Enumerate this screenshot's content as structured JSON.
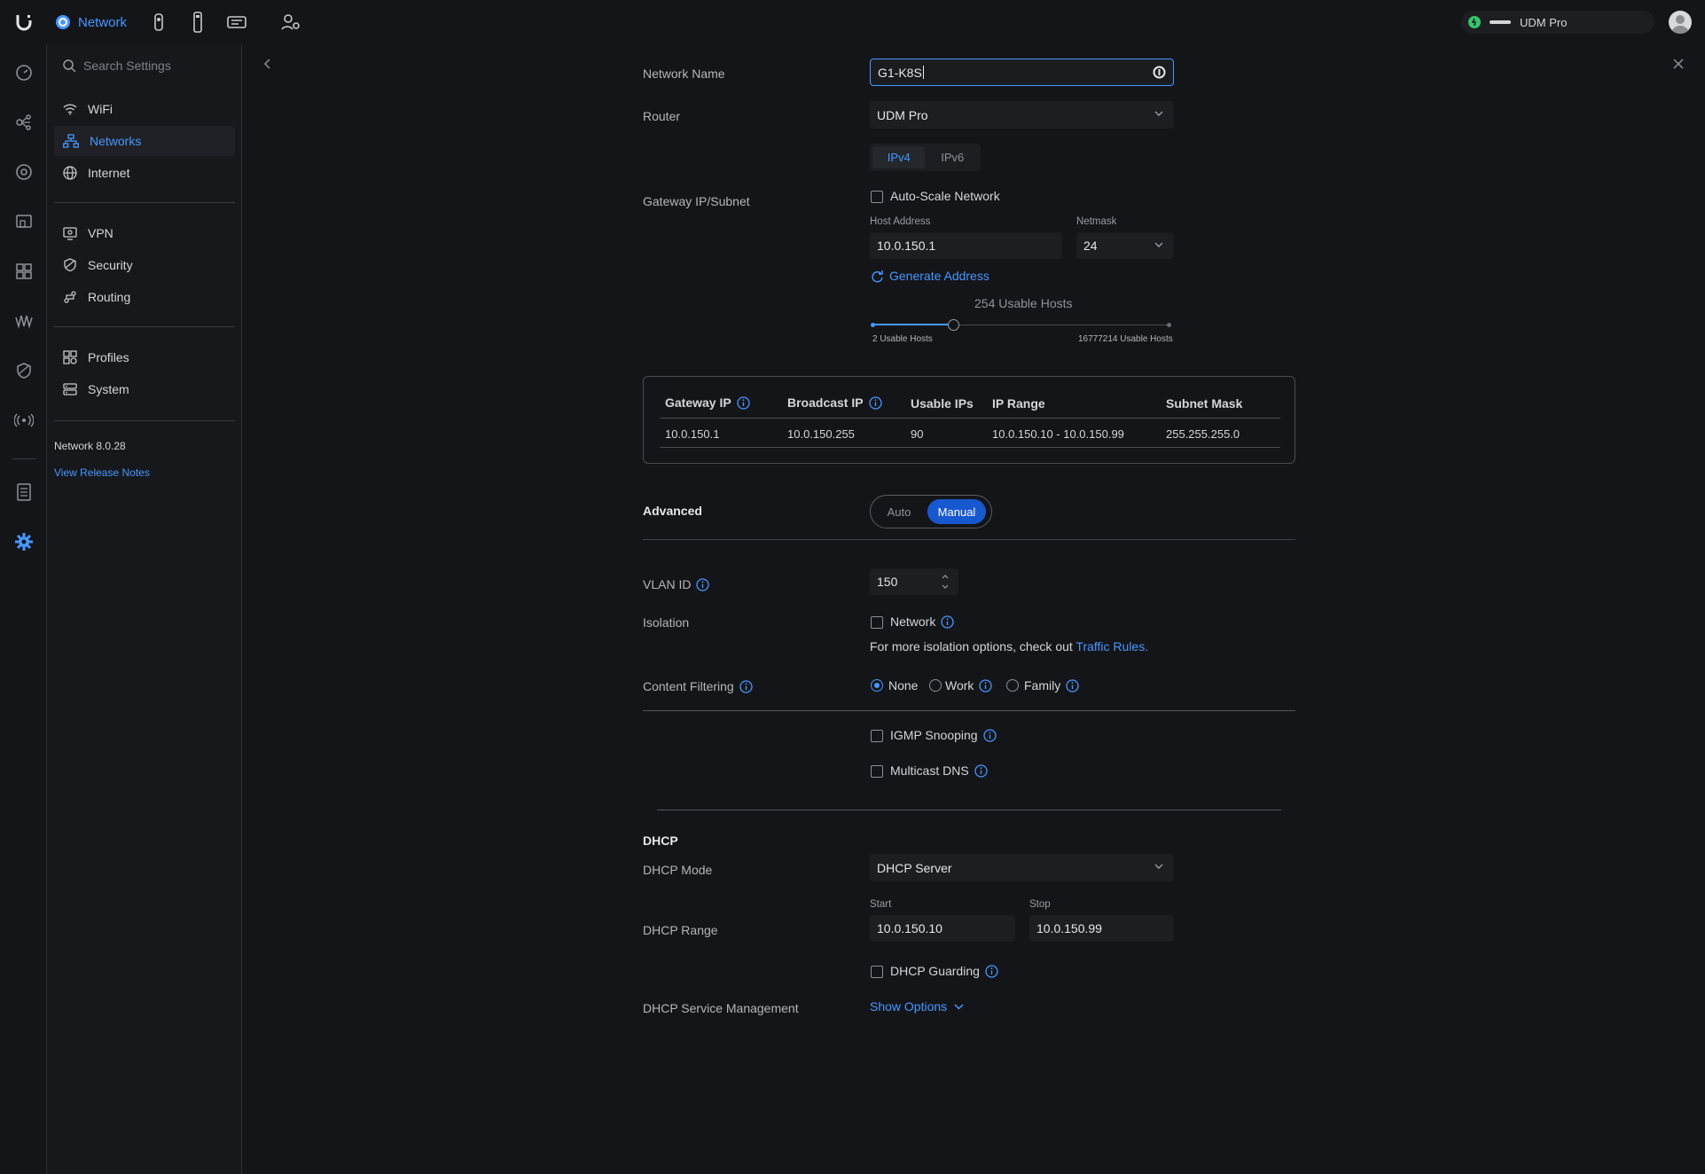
{
  "topbar": {
    "app_label": "Network",
    "device_name": "UDM Pro"
  },
  "sidebar": {
    "search_placeholder": "Search Settings",
    "items": [
      {
        "label": "WiFi",
        "icon": "wifi-icon"
      },
      {
        "label": "Networks",
        "icon": "networks-icon"
      },
      {
        "label": "Internet",
        "icon": "globe-icon"
      },
      {
        "label": "VPN",
        "icon": "vpn-icon"
      },
      {
        "label": "Security",
        "icon": "shield-icon"
      },
      {
        "label": "Routing",
        "icon": "routing-icon"
      },
      {
        "label": "Profiles",
        "icon": "profiles-icon"
      },
      {
        "label": "System",
        "icon": "system-icon"
      }
    ],
    "version": "Network 8.0.28",
    "release_notes": "View Release Notes"
  },
  "form": {
    "network_name_label": "Network Name",
    "network_name_value": "G1-K8S",
    "router_label": "Router",
    "router_value": "UDM Pro",
    "ip_tabs": [
      "IPv4",
      "IPv6"
    ],
    "gateway_label": "Gateway IP/Subnet",
    "autoscale_label": "Auto-Scale Network",
    "host_address_label": "Host Address",
    "host_address_value": "10.0.150.1",
    "netmask_label": "Netmask",
    "netmask_value": "24",
    "generate_label": "Generate Address",
    "usable_hosts": "254 Usable Hosts",
    "slider_min": "2 Usable Hosts",
    "slider_max": "16777214 Usable Hosts",
    "slider_fraction": 0.27
  },
  "subnet_table": {
    "headers": [
      "Gateway IP",
      "Broadcast IP",
      "Usable IPs",
      "IP Range",
      "Subnet Mask"
    ],
    "row": [
      "10.0.150.1",
      "10.0.150.255",
      "90",
      "10.0.150.10 - 10.0.150.99",
      "255.255.255.0"
    ]
  },
  "advanced": {
    "label": "Advanced",
    "options": [
      "Auto",
      "Manual"
    ],
    "selected": "Manual",
    "vlan_label": "VLAN ID",
    "vlan_value": "150",
    "isolation_label": "Isolation",
    "isolation_option": "Network",
    "isolation_hint": "For more isolation options, check out",
    "traffic_rules": "Traffic Rules.",
    "content_filter_label": "Content Filtering",
    "content_options": [
      "None",
      "Work",
      "Family"
    ],
    "igmp_label": "IGMP Snooping",
    "mdns_label": "Multicast DNS"
  },
  "dhcp": {
    "section_title": "DHCP",
    "mode_label": "DHCP Mode",
    "mode_value": "DHCP Server",
    "range_label": "DHCP Range",
    "start_label": "Start",
    "start_value": "10.0.150.10",
    "stop_label": "Stop",
    "stop_value": "10.0.150.99",
    "guarding_label": "DHCP Guarding",
    "service_label": "DHCP Service Management",
    "show_options": "Show Options"
  },
  "colors": {
    "accent": "#4797ff",
    "background": "#141519",
    "input_bg": "#1c1e22",
    "manual_pill": "#1858cf"
  }
}
